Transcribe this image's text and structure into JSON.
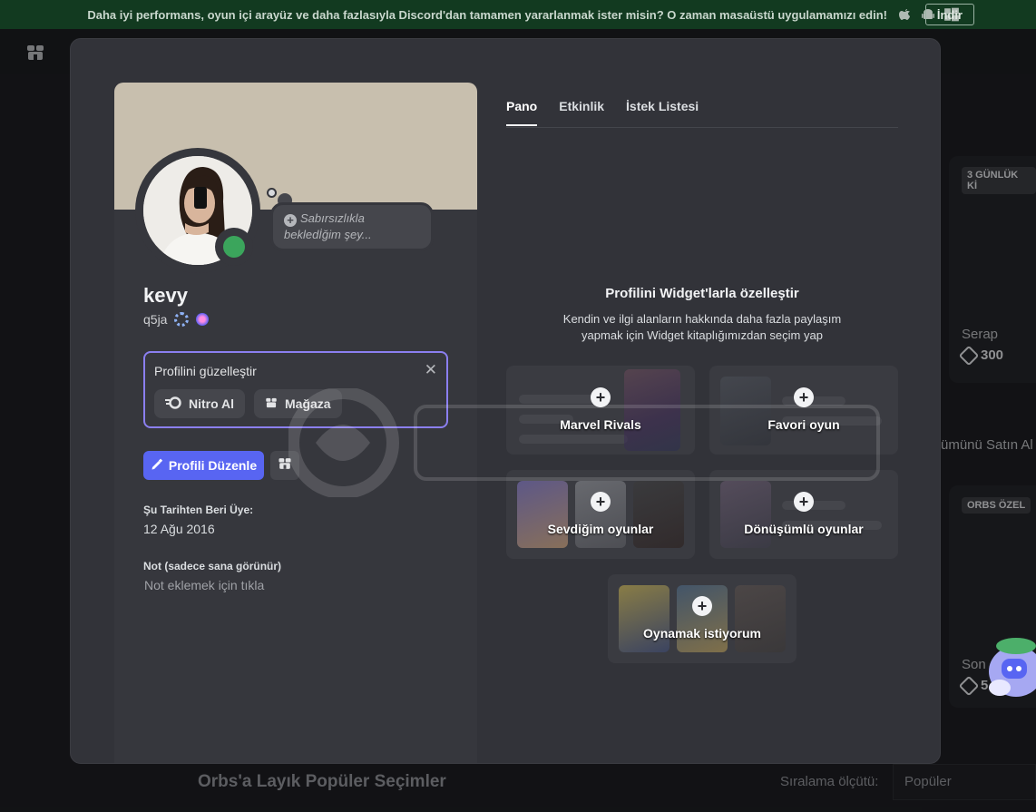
{
  "banner": {
    "text": "Daha iyi performans, oyun içi arayüz ve daha fazlasıyla Discord'dan tamamen yararlanmak ister misin? O zaman masaüstü uygulamamızı edin!",
    "download_label": "İndir",
    "os_icons": [
      "apple-icon",
      "android-icon",
      "windows-icon"
    ]
  },
  "background": {
    "cards": [
      {
        "badge": "3 GÜNLÜK Kİ",
        "name": "Serap",
        "price": "300"
      },
      {
        "badge": "ORBS ÖZEL",
        "name": "Son",
        "price": "5"
      }
    ],
    "side_text": "ümünü Satın Al",
    "section_title": "Orbs'a Layık Popüler Seçimler",
    "sort_label": "Sıralama ölçütü:",
    "sort_value": "Popüler"
  },
  "profile": {
    "display_name": "kevy",
    "username": "q5ja",
    "status_bubble": "Sabırsızlıkla bekledİğim şey...",
    "customize": {
      "title": "Profilini güzelleştir",
      "nitro_label": "Nitro Al",
      "shop_label": "Mağaza"
    },
    "edit_label": "Profili Düzenle",
    "member_since_label": "Şu Tarihten Beri Üye:",
    "member_since": "12 Ağu 2016",
    "note_label": "Not (sadece sana görünür)",
    "note_placeholder": "Not eklemek için tıkla"
  },
  "tabs": [
    "Pano",
    "Etkinlik",
    "İstek Listesi"
  ],
  "widgets": {
    "title": "Profilini Widget'larla özelleştir",
    "subtitle": "Kendin ve ilgi alanların hakkında daha fazla paylaşım yapmak için Widget kitaplığımızdan seçim yap",
    "cards": [
      {
        "label": "Marvel Rivals"
      },
      {
        "label": "Favori oyun"
      },
      {
        "label": "Sevdiğim oyunlar"
      },
      {
        "label": "Dönüşümlü oyunlar"
      },
      {
        "label": "Oynamak istiyorum"
      }
    ]
  },
  "colors": {
    "accent": "#5865f2",
    "status_online": "#3ba55c",
    "banner_bg": "#c8bfae",
    "customize_border": "#8b7ff0"
  }
}
